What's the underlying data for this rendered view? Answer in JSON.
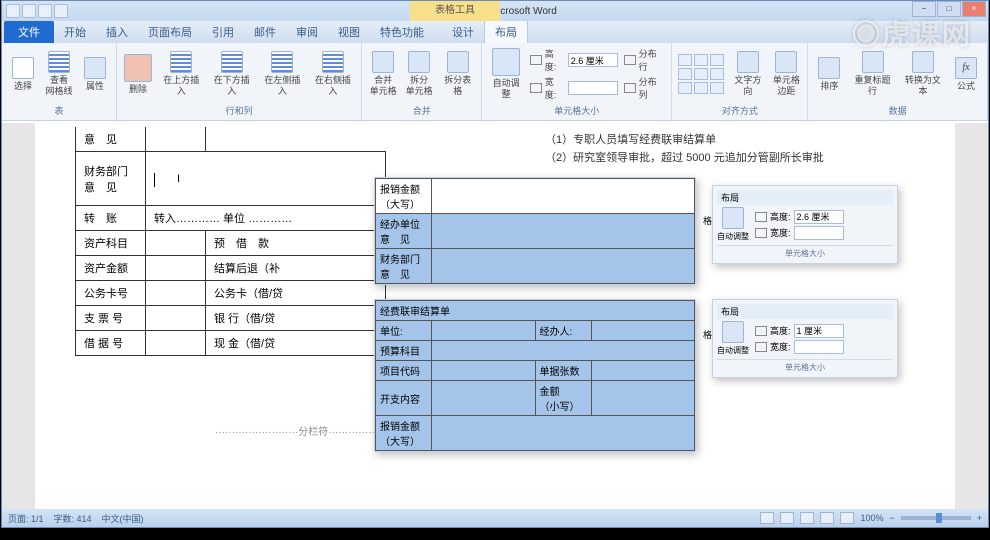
{
  "window": {
    "title": "Word.docx - Microsoft Word",
    "table_tools": "表格工具",
    "min": "−",
    "max": "□",
    "close": "×"
  },
  "tabs": {
    "file": "文件",
    "home": "开始",
    "insert": "插入",
    "pagelayout": "页面布局",
    "references": "引用",
    "mailings": "邮件",
    "review": "审阅",
    "view": "视图",
    "special": "特色功能",
    "design": "设计",
    "layout": "布局"
  },
  "ribbon": {
    "select": "选择",
    "gridlines": "查看\n网格线",
    "properties": "属性",
    "delete": "删除",
    "insert_above": "在上方插入",
    "insert_below": "在下方插入",
    "insert_left": "在左侧插入",
    "insert_right": "在右侧插入",
    "merge": "合并\n单元格",
    "split_cell": "拆分\n单元格",
    "split_table": "拆分表格",
    "autofit": "自动调整",
    "height_label": "高度:",
    "height_val": "2.6 厘米",
    "width_label": "宽度:",
    "width_val": "",
    "dist_rows": "分布行",
    "dist_cols": "分布列",
    "text_dir": "文字方向",
    "cell_margins": "单元格\n边距",
    "sort": "排序",
    "repeat_header": "重复标题行",
    "convert": "转换为文本",
    "formula": "公式",
    "grp_table": "表",
    "grp_rowcol": "行和列",
    "grp_merge": "合并",
    "grp_cellsize": "单元格大小",
    "grp_align": "对齐方式",
    "grp_data": "数据"
  },
  "document": {
    "note1": "（1）专职人员填写经费联审结算单",
    "note2": "（2）研究室领导审批，超过 5000 元追加分管副所长审批",
    "leftcol": {
      "r0": "意　见",
      "r1": "财务部门\n意　见",
      "r2l": "转　账",
      "r2r": "转入………… 单位 …………",
      "r3l": "资产科目",
      "r3r": "预　借　款",
      "r4l": "资产金额",
      "r4r": "结算后退（补",
      "r5l": "公务卡号",
      "r5r": "公务卡（借/贷",
      "r6l": "支 票 号",
      "r6r": "银 行（借/贷",
      "r7l": "借 据 号",
      "r7r": "现 金（借/贷"
    },
    "divider": "分栏符"
  },
  "float1": {
    "r1": "报销金额\n（大写）",
    "r2": "经办单位\n意　见",
    "r3": "财务部门\n意　见"
  },
  "float2": {
    "title": "经费联审结算单",
    "r1a": "单位:",
    "r1b": "经办人:",
    "r2": "预算科目",
    "r3a": "项目代码",
    "r3b": "单据张数",
    "r4a": "开支内容",
    "r4b": "金额\n（小写）",
    "r5": "报销金额\n（大写）"
  },
  "mini_ribbon": {
    "tab": "布局",
    "autofit": "自动调整",
    "h_label": "高度:",
    "h1": "2.6 厘米",
    "h2": "1 厘米",
    "w_label": "宽度:",
    "grid": "格",
    "footer": "单元格大小"
  },
  "statusbar": {
    "page": "页面: 1/1",
    "words": "字数: 414",
    "lang": "中文(中国)",
    "zoom": "100%"
  },
  "watermark": "虎课网"
}
